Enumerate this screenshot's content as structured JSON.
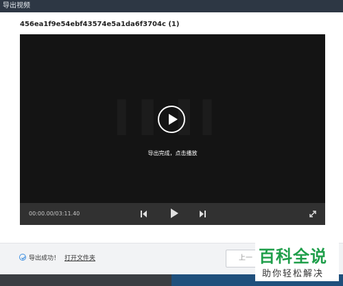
{
  "window": {
    "title": "导出视频"
  },
  "file": {
    "title": "456ea1f9e54ebf43574e5a1da6f3704c (1)"
  },
  "player": {
    "message": "导出完成，点击播放",
    "time": "00:00.00/03:11.40",
    "icons": [
      "play-icon",
      "skip-back-icon",
      "skip-forward-icon",
      "fullscreen-icon"
    ]
  },
  "footer": {
    "success_text": "导出成功！",
    "open_folder": "打开文件夹",
    "prev_button": "上一"
  },
  "watermark": {
    "main": "百科全说",
    "sub": "助你轻松解决"
  },
  "colors": {
    "titlebar": "#2d3744",
    "player_bg": "#141414",
    "controls_bg": "#313131",
    "accent": "#3d8fe0",
    "logo_green": "#1f9e4a"
  }
}
